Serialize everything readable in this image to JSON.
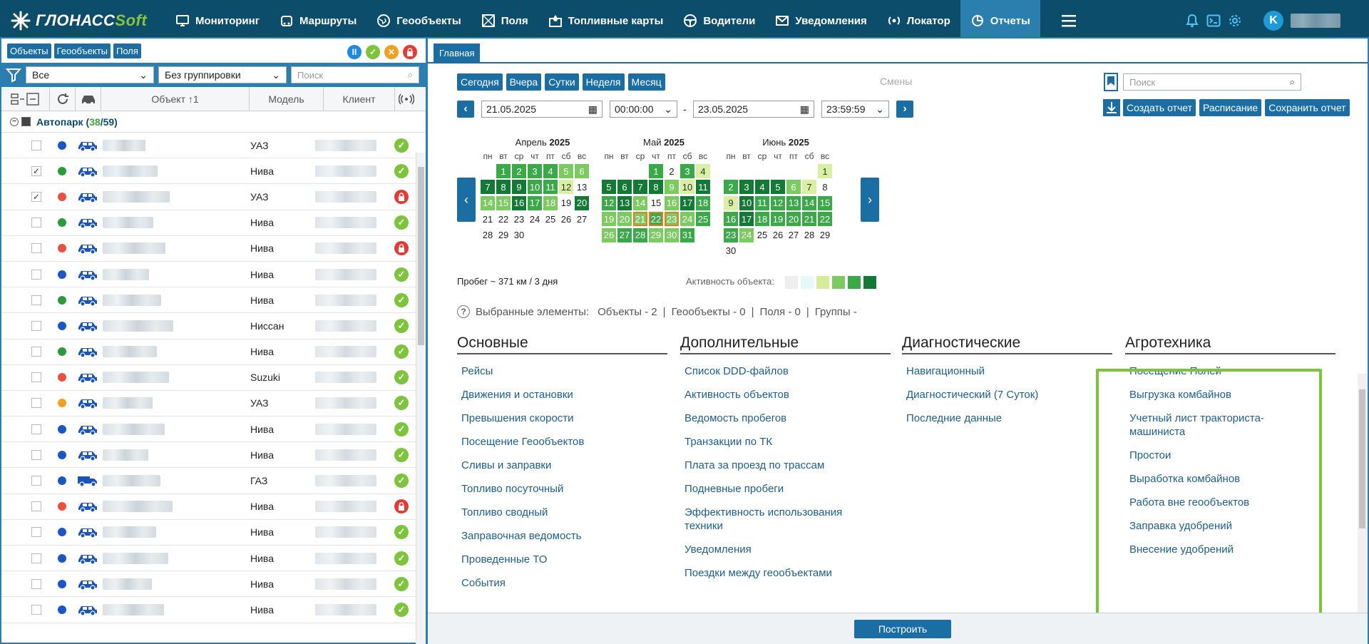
{
  "brand": {
    "logo_main": "ГЛОНАСС",
    "logo_soft": "Soft"
  },
  "nav": [
    {
      "label": "Мониторинг",
      "icon": "monitor-icon"
    },
    {
      "label": "Маршруты",
      "icon": "route-icon"
    },
    {
      "label": "Геообъекты",
      "icon": "globe-icon"
    },
    {
      "label": "Поля",
      "icon": "field-icon"
    },
    {
      "label": "Топливные карты",
      "icon": "fuel-icon"
    },
    {
      "label": "Водители",
      "icon": "steering-wheel-icon"
    },
    {
      "label": "Уведомления",
      "icon": "mail-icon"
    },
    {
      "label": "Локатор",
      "icon": "locator-icon"
    },
    {
      "label": "Отчеты",
      "icon": "reports-icon",
      "active": true
    }
  ],
  "user": {
    "initial": "K"
  },
  "left": {
    "tabs": [
      "Объекты",
      "Геообъекты",
      "Поля"
    ],
    "filter_value": "Все",
    "grouping_value": "Без группировки",
    "search_placeholder": "Поиск",
    "columns": {
      "object": "Объект ↑1",
      "model": "Модель",
      "client": "Клиент"
    },
    "group": {
      "name": "Автопарк",
      "active": "38",
      "total": "59"
    },
    "rows": [
      {
        "model": "УАЗ",
        "dot": "#1a56c4",
        "checked": false,
        "status": "ok"
      },
      {
        "model": "Нива",
        "dot": "#2a9a3a",
        "checked": true,
        "status": "ok"
      },
      {
        "model": "УАЗ",
        "dot": "#ee4f3f",
        "checked": true,
        "status": "lock"
      },
      {
        "model": "Нива",
        "dot": "#2a9a3a",
        "checked": false,
        "status": "ok"
      },
      {
        "model": "Нива",
        "dot": "#ee4f3f",
        "checked": false,
        "status": "lock"
      },
      {
        "model": "Нива",
        "dot": "#1a56c4",
        "checked": false,
        "status": "ok"
      },
      {
        "model": "Нива",
        "dot": "#2a9a3a",
        "checked": false,
        "status": "ok"
      },
      {
        "model": "Ниссан",
        "dot": "#1a56c4",
        "checked": false,
        "status": "ok"
      },
      {
        "model": "Нива",
        "dot": "#2a9a3a",
        "checked": false,
        "status": "ok"
      },
      {
        "model": "Suzuki",
        "dot": "#ee4f3f",
        "checked": false,
        "status": "ok"
      },
      {
        "model": "УАЗ",
        "dot": "#f2a01e",
        "checked": false,
        "status": "ok"
      },
      {
        "model": "Нива",
        "dot": "#1a56c4",
        "checked": false,
        "status": "ok"
      },
      {
        "model": "Нива",
        "dot": "#1a56c4",
        "checked": false,
        "status": "ok"
      },
      {
        "model": "ГАЗ",
        "dot": "#1a56c4",
        "checked": false,
        "status": "ok",
        "truck": true
      },
      {
        "model": "Нива",
        "dot": "#ee4f3f",
        "checked": false,
        "status": "lock"
      },
      {
        "model": "Нива",
        "dot": "#1a56c4",
        "checked": false,
        "status": "ok"
      },
      {
        "model": "Нива",
        "dot": "#1a56c4",
        "checked": false,
        "status": "ok"
      },
      {
        "model": "Нива",
        "dot": "#1a56c4",
        "checked": false,
        "status": "ok"
      },
      {
        "model": "Нива",
        "dot": "#1a56c4",
        "checked": false,
        "status": "ok"
      }
    ]
  },
  "right": {
    "tab": "Главная",
    "quick": [
      "Сегодня",
      "Вчера",
      "Сутки",
      "Неделя",
      "Месяц"
    ],
    "shifts": "Смены",
    "search_placeholder": "Поиск",
    "date_from": "21.05.2025",
    "time_from": "00:00:00",
    "dash": "-",
    "date_to": "23.05.2025",
    "time_to": "23:59:59",
    "actions": [
      "Создать отчет",
      "Расписание",
      "Сохранить отчет"
    ],
    "weekdays": [
      "пн",
      "вт",
      "ср",
      "чт",
      "пт",
      "сб",
      "вс"
    ],
    "months": [
      {
        "name": "Апрель",
        "year": "2025",
        "offset": 1,
        "days": 30,
        "levels": [
          3,
          3,
          3,
          3,
          2,
          2,
          4,
          4,
          4,
          3,
          3,
          1,
          0,
          2,
          2,
          4,
          3,
          2,
          0,
          4,
          0,
          0,
          0,
          0,
          0,
          0,
          0,
          0,
          0,
          0
        ]
      },
      {
        "name": "Май",
        "year": "2025",
        "offset": 3,
        "days": 31,
        "levels": [
          3,
          0,
          3,
          1,
          4,
          4,
          4,
          4,
          2,
          1,
          4,
          3,
          4,
          2,
          0,
          2,
          4,
          3,
          2,
          2,
          2,
          3,
          2,
          2,
          3,
          2,
          3,
          3,
          2,
          2,
          3
        ]
      },
      {
        "name": "Июнь",
        "year": "2025",
        "offset": 6,
        "days": 30,
        "levels": [
          1,
          3,
          4,
          4,
          4,
          2,
          1,
          0,
          1,
          4,
          3,
          3,
          3,
          3,
          3,
          3,
          4,
          3,
          3,
          3,
          3,
          3,
          3,
          2,
          0,
          0,
          0,
          0,
          0,
          0
        ]
      }
    ],
    "mileage": "Пробег ~ 371 км / 3 дня",
    "activity_label": "Активность объекта:",
    "activity_colors": [
      "#eeeeee",
      "#e6f9f9",
      "#d6ec9c",
      "#7ccb61",
      "#3aa948",
      "#127a35"
    ],
    "selected": {
      "label": "Выбранные элементы:",
      "objects": "Объекты - 2",
      "geo": "Геообъекты - 0",
      "fields": "Поля - 0",
      "groups": "Группы -",
      "sep": "|"
    },
    "sections": [
      {
        "title": "Основные",
        "items": [
          "Рейсы",
          "Движения и остановки",
          "Превышения скорости",
          "Посещение Геообъектов",
          "Сливы и заправки",
          "Топливо посуточный",
          "Топливо сводный",
          "Заправочная ведомость",
          "Проведенные ТО",
          "События"
        ]
      },
      {
        "title": "Дополнительные",
        "items": [
          "Список DDD-файлов",
          "Активность объектов",
          "Ведомость пробегов",
          "Транзакции по ТК",
          "Плата за проезд по трассам",
          "Подневные пробеги",
          "Эффективность использования техники",
          "Уведомления",
          "Поездки между геообъектами"
        ]
      },
      {
        "title": "Диагностические",
        "items": [
          "Навигационный",
          "Диагностический (7 Суток)",
          "Последние данные"
        ]
      },
      {
        "title": "Агротехника",
        "items": [
          "Посещение Полей",
          "Выгрузка комбайнов",
          "Учетный лист тракториста-машиниста",
          "Простои",
          "Выработка комбайнов",
          "Работа вне геообъектов",
          "Заправка удобрений",
          "Внесение удобрений"
        ]
      }
    ],
    "build": "Построить"
  }
}
